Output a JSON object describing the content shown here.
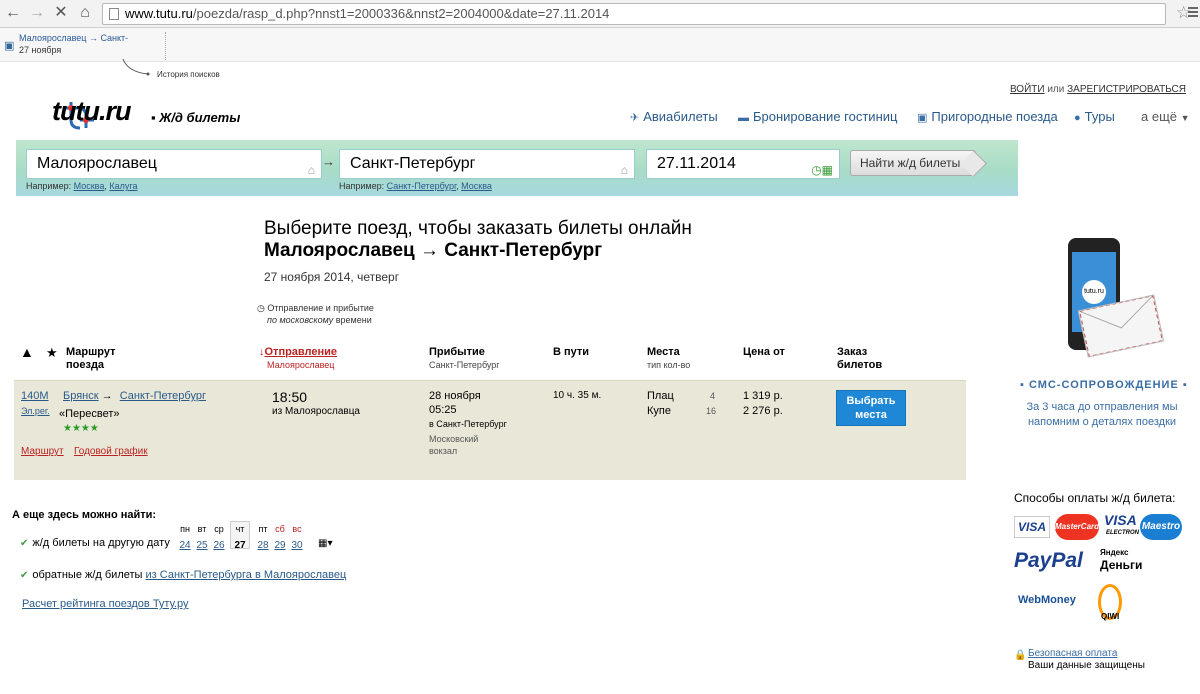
{
  "browser": {
    "url_host": "www.tutu.ru",
    "url_path": "/poezda/rasp_d.php?nnst1=2000336&nnst2=2004000&date=27.11.2014"
  },
  "history": {
    "title": "Малоярославец → Санкт-",
    "date": "27 ноября",
    "caption": "История поисков"
  },
  "auth": {
    "login": "ВОЙТИ",
    "or": "или",
    "register": "ЗАРЕГИСТРИРОВАТЬСЯ"
  },
  "header": {
    "logo": "tutu.ru",
    "section": "Ж/д билеты",
    "nav": [
      "Авиабилеты",
      "Бронирование гостиниц",
      "Пригородные поезда",
      "Туры",
      "а ещё"
    ]
  },
  "search": {
    "from": "Малоярославец",
    "to": "Санкт-Петербург",
    "date": "27.11.2014",
    "button": "Найти ж/д билеты",
    "example_label": "Например:",
    "from_examples": [
      "Москва",
      "Калуга"
    ],
    "to_examples": [
      "Санкт-Петербург",
      "Москва"
    ]
  },
  "main": {
    "title": "Выберите поезд, чтобы заказать билеты онлайн",
    "route": "Малоярославец → Санкт-Петербург",
    "date": "27 ноября 2014, четверг",
    "tz_line1": "Отправление и прибытие",
    "tz_line2": "по московскому",
    "tz_line3": "времени"
  },
  "table_header": {
    "route": "Маршрут",
    "route2": "поезда",
    "departure": "Отправление",
    "departure_sub": "Малоярославец",
    "arrival": "Прибытие",
    "arrival_sub": "Санкт-Петербург",
    "duration": "В пути",
    "seats": "Места",
    "seats_sub": "тип кол-во",
    "price": "Цена от",
    "order": "Заказ",
    "order2": "билетов"
  },
  "train": {
    "number": "140М",
    "type": "Эл.рег.",
    "from": "Брянск",
    "to": "Санкт-Петербург",
    "name": "«Пересвет»",
    "stars": "★★★★",
    "route_link": "Маршрут",
    "schedule_link": "Годовой график",
    "dep_time": "18:50",
    "dep_from": "из Малоярославца",
    "arr_date": "28 ноября",
    "arr_time": "05:25",
    "arr_to": "в Санкт-Петербург",
    "station1": "Московский",
    "station2": "вокзал",
    "duration": "10 ч. 35 м.",
    "seat_types": [
      {
        "type": "Плац",
        "count": "4",
        "price": "1 319 р."
      },
      {
        "type": "Купе",
        "count": "16",
        "price": "2 276 р."
      }
    ],
    "button_line1": "Выбрать",
    "button_line2": "места"
  },
  "also": {
    "title": "А еще здесь можно найти:",
    "other_date": "ж/д билеты на другую дату",
    "days": [
      {
        "wd": "пн",
        "d": "24"
      },
      {
        "wd": "вт",
        "d": "25"
      },
      {
        "wd": "ср",
        "d": "26"
      },
      {
        "wd": "чт",
        "d": "27"
      },
      {
        "wd": "пт",
        "d": "28"
      },
      {
        "wd": "сб",
        "d": "29"
      },
      {
        "wd": "вс",
        "d": "30"
      }
    ],
    "return_text": "обратные ж/д билеты",
    "return_link": "из Санкт-Петербурга в Малоярославец",
    "rating": "Расчет рейтинга поездов Туту.ру"
  },
  "sidebar": {
    "phone_logo": "tutu.ru",
    "sms_title": "СМС-СОПРОВОЖДЕНИЕ",
    "sms_text": "За 3 часа до отправления мы напомним о деталях поездки",
    "pay_title": "Способы оплаты ж/д билета:",
    "payments": [
      "VISA",
      "MasterCard",
      "VISA",
      "ELECTRON",
      "Maestro",
      "PayPal",
      "Яндекс",
      "Деньги",
      "WebMoney",
      "QIWI"
    ],
    "secure1": "Безопасная оплата",
    "secure2": "Ваши данные защищены"
  },
  "colors": {
    "link": "#2a5a8a",
    "accent_red": "#bb2222",
    "button_blue": "#1e87d6",
    "row_bg": "#e9e8d8"
  }
}
